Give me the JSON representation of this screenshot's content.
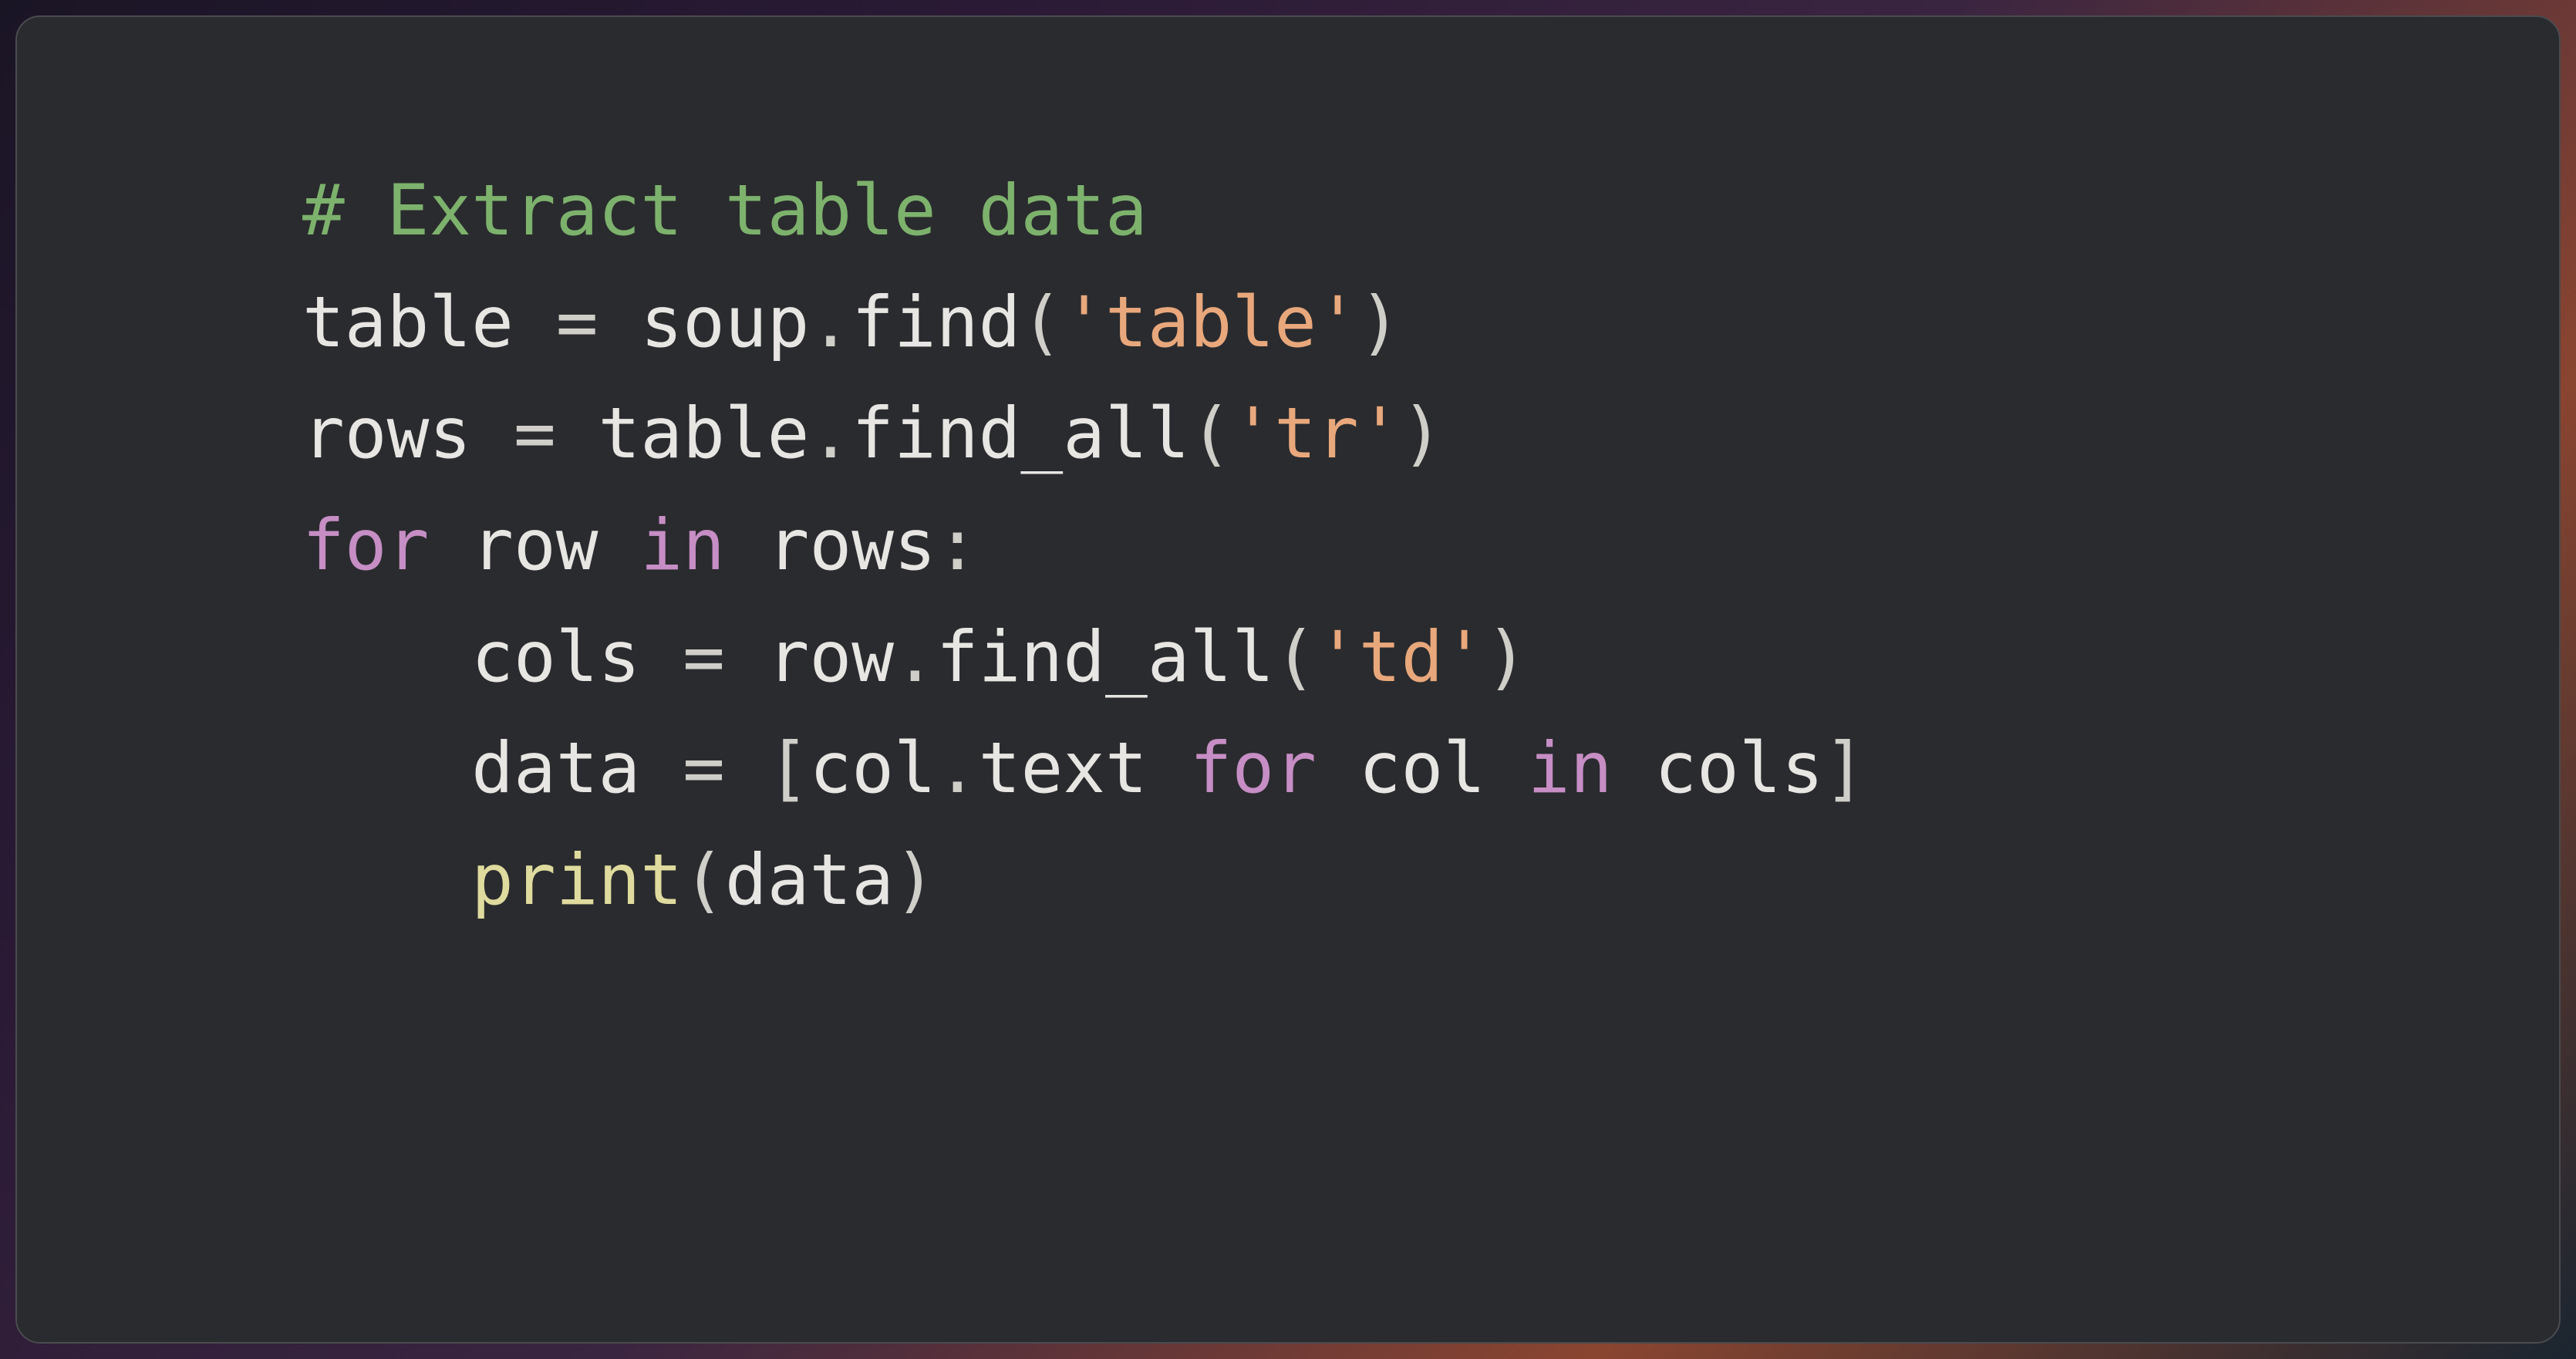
{
  "code": {
    "line1": {
      "comment": "# Extract table data"
    },
    "line2": {
      "text1": "table ",
      "op1": "=",
      "text2": " soup",
      "dot1": ".",
      "method1": "find",
      "paren1": "(",
      "str1": "'table'",
      "paren2": ")"
    },
    "line3": {
      "text1": "rows ",
      "op1": "=",
      "text2": " table",
      "dot1": ".",
      "method1": "find_all",
      "paren1": "(",
      "str1": "'tr'",
      "paren2": ")"
    },
    "line4": {
      "kw1": "for",
      "text1": " row ",
      "kw2": "in",
      "text2": " rows",
      "colon": ":"
    },
    "line5": {
      "indent": "    ",
      "text1": "cols ",
      "op1": "=",
      "text2": " row",
      "dot1": ".",
      "method1": "find_all",
      "paren1": "(",
      "str1": "'td'",
      "paren2": ")"
    },
    "line6": {
      "indent": "    ",
      "text1": "data ",
      "op1": "=",
      "text2": " ",
      "bracket1": "[",
      "text3": "col",
      "dot1": ".",
      "attr1": "text ",
      "kw1": "for",
      "text4": " col ",
      "kw2": "in",
      "text5": " cols",
      "bracket2": "]"
    },
    "line7": {
      "indent": "    ",
      "builtin1": "print",
      "paren1": "(",
      "text1": "data",
      "paren2": ")"
    }
  }
}
